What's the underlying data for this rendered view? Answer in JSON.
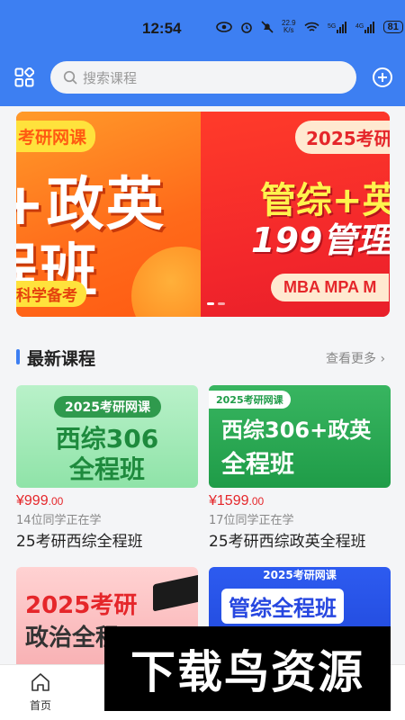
{
  "status_bar": {
    "time": "12:54",
    "net_speed_top": "22.9",
    "net_speed_unit": "K/s",
    "battery": "81",
    "icons": [
      "eye-icon",
      "alarm-icon",
      "mute-icon",
      "wifi-icon",
      "5g-signal-icon",
      "4g-signal-icon"
    ]
  },
  "header": {
    "search_placeholder": "搜索课程",
    "left_icon": "category-grid-icon",
    "right_icon": "add-circle-icon"
  },
  "banner": {
    "slide_a": {
      "tag": "考研网课",
      "line1": "+政英",
      "line2": "程班",
      "sub": "科学备考"
    },
    "slide_b": {
      "tag": "2025考研",
      "line1": "管综+英",
      "line2": "199管理",
      "strip": "MBA MPA M"
    }
  },
  "section": {
    "title": "最新课程",
    "more": "查看更多"
  },
  "courses": [
    {
      "thumb_pill": "2025考研网课",
      "thumb_line1": "西综306",
      "thumb_line2": "全程班",
      "price_symbol": "¥",
      "price_main": "999",
      "price_cents": ".00",
      "learners": "14位同学正在学",
      "name": "25考研西综全程班"
    },
    {
      "thumb_pill": "2025考研网课",
      "thumb_line1": "西综306+政英",
      "thumb_line2": "全程班",
      "price_symbol": "¥",
      "price_main": "1599",
      "price_cents": ".00",
      "learners": "17位同学正在学",
      "name": "25考研西综政英全程班"
    },
    {
      "thumb_line1": "2025考研",
      "thumb_line2": "政治全程"
    },
    {
      "thumb_top": "2025考研网课",
      "thumb_line1": "管综全程班"
    }
  ],
  "nav": {
    "home_label": "首页"
  },
  "watermark": "下载鸟资源",
  "colors": {
    "header_blue": "#3d7ff2",
    "price_red": "#e5262a"
  }
}
